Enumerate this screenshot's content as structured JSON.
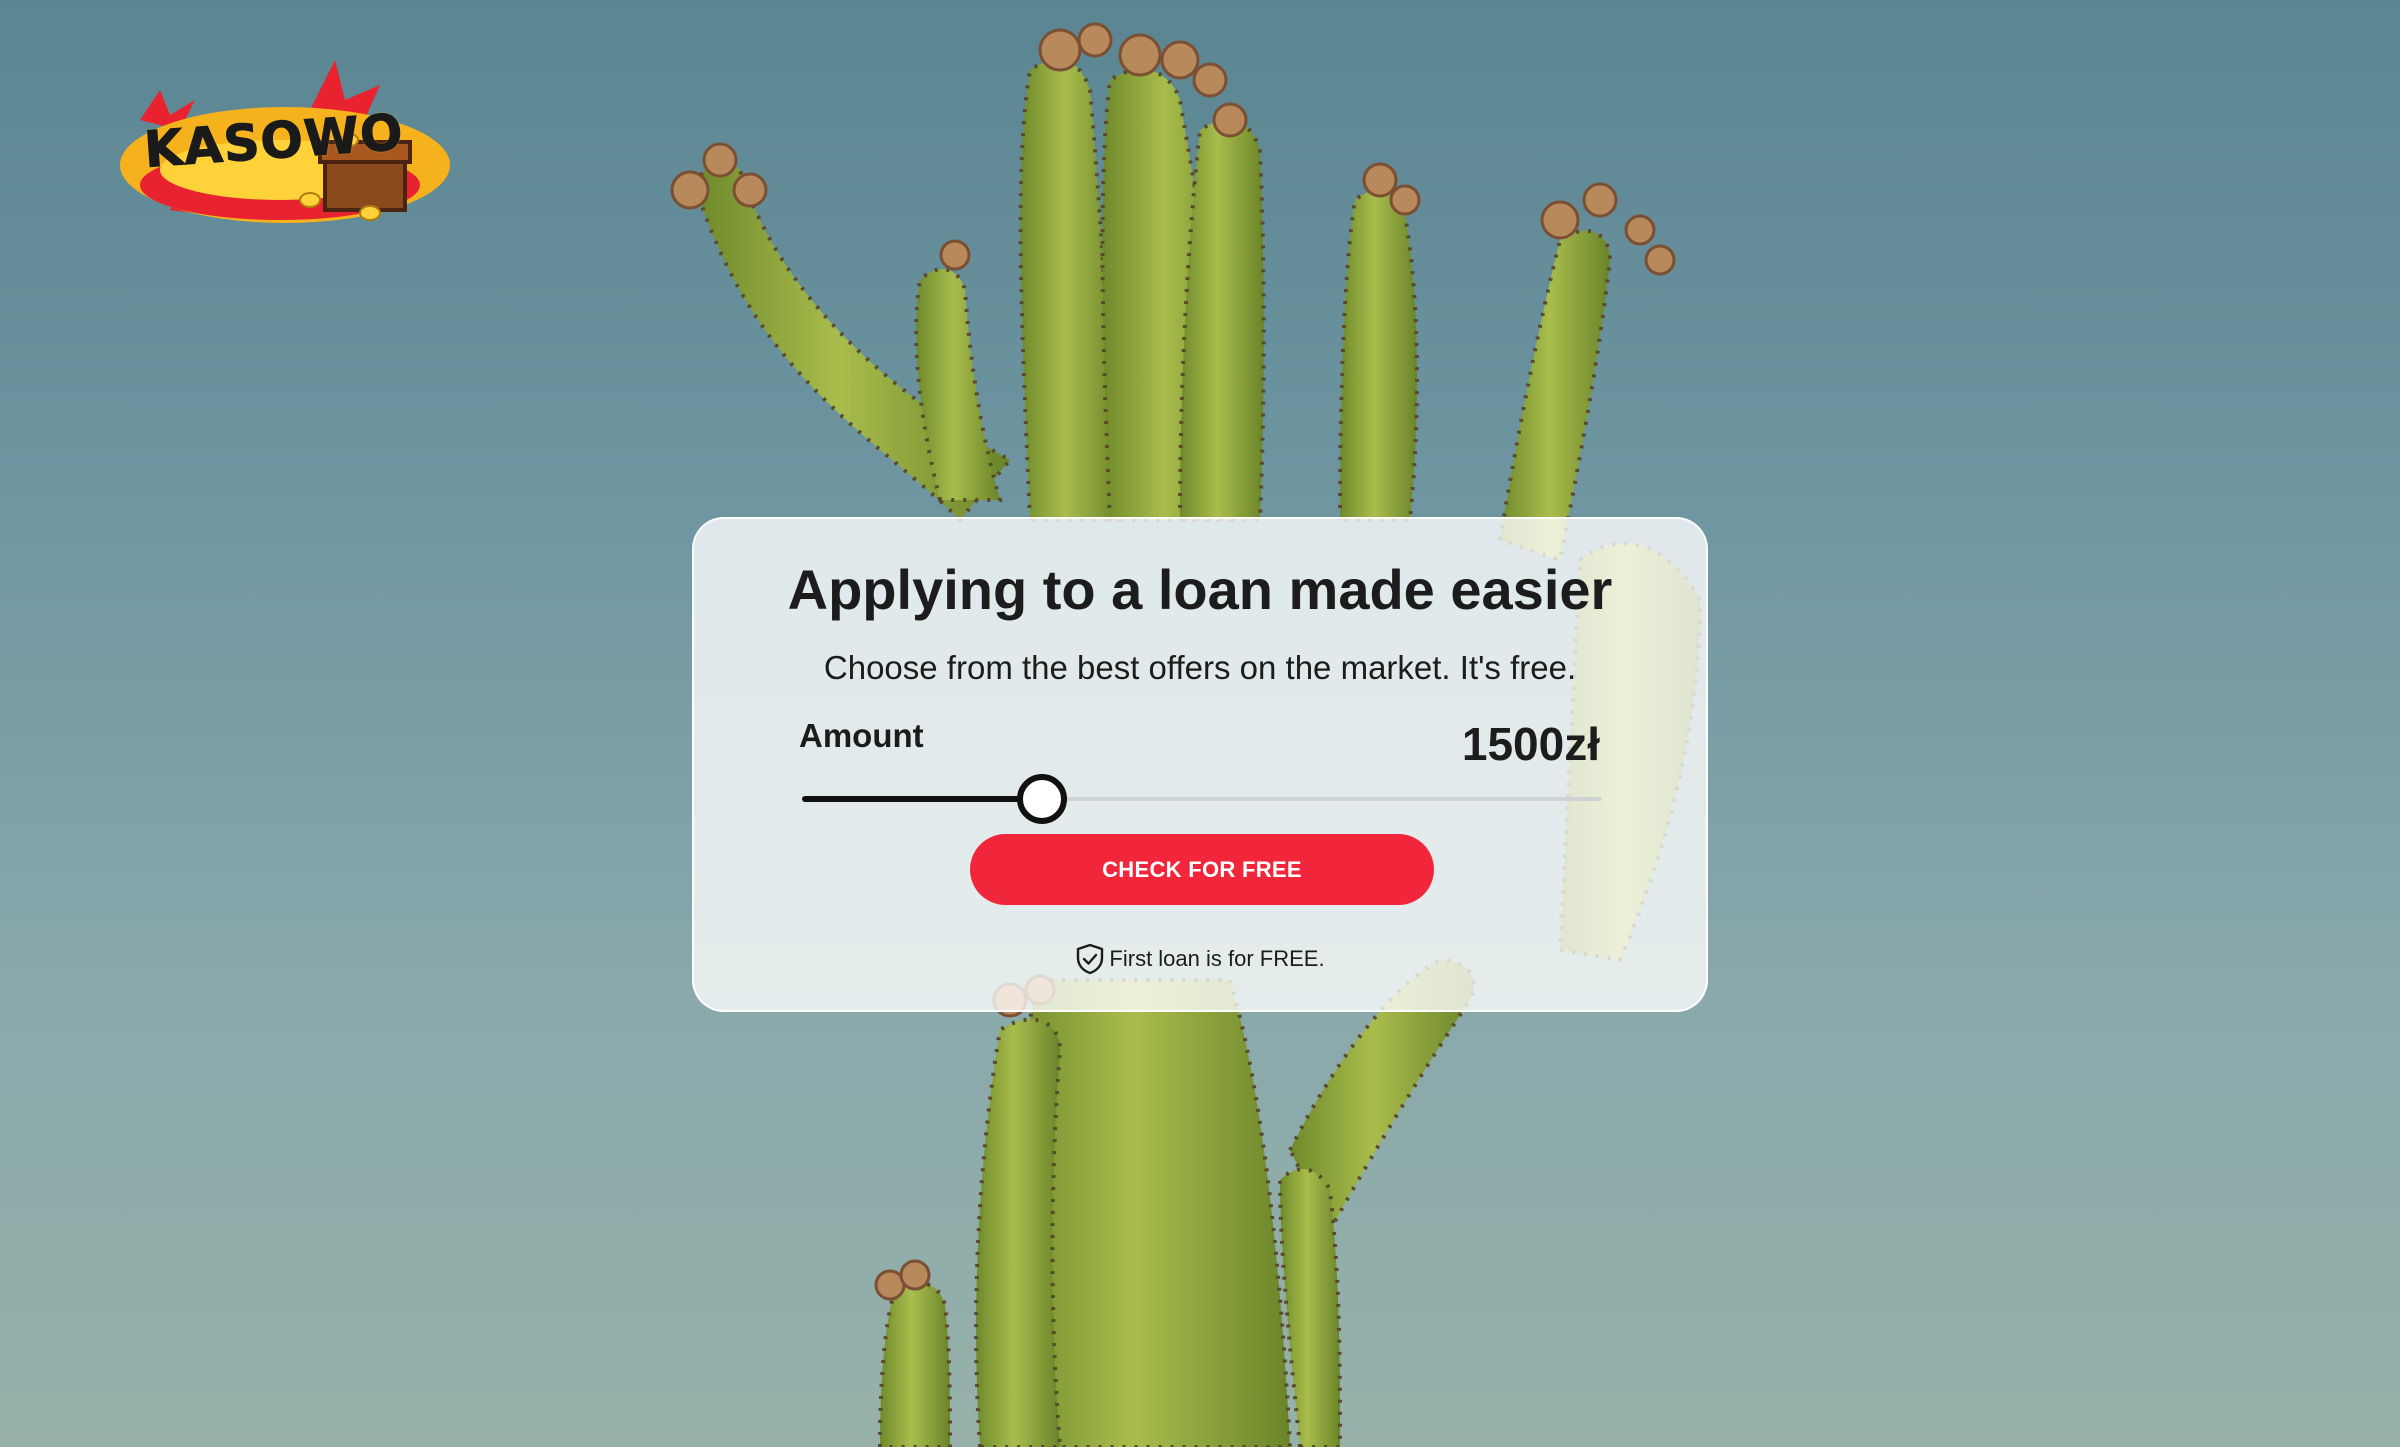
{
  "brand": {
    "logo_text": "KASOWO"
  },
  "hero": {
    "title": "Applying to a loan made easier",
    "subtitle": "Choose from the best offers on the market. It's free."
  },
  "loan_form": {
    "amount_label": "Amount",
    "amount_value": "1500zł",
    "slider_fraction": 0.3,
    "cta_label": "CHECK FOR FREE",
    "note_text": "First loan is for FREE.",
    "note_icon": "shield-check-icon"
  },
  "colors": {
    "accent": "#f2263a",
    "sky": "#6f96a1",
    "cactus": "#8fab3c"
  }
}
